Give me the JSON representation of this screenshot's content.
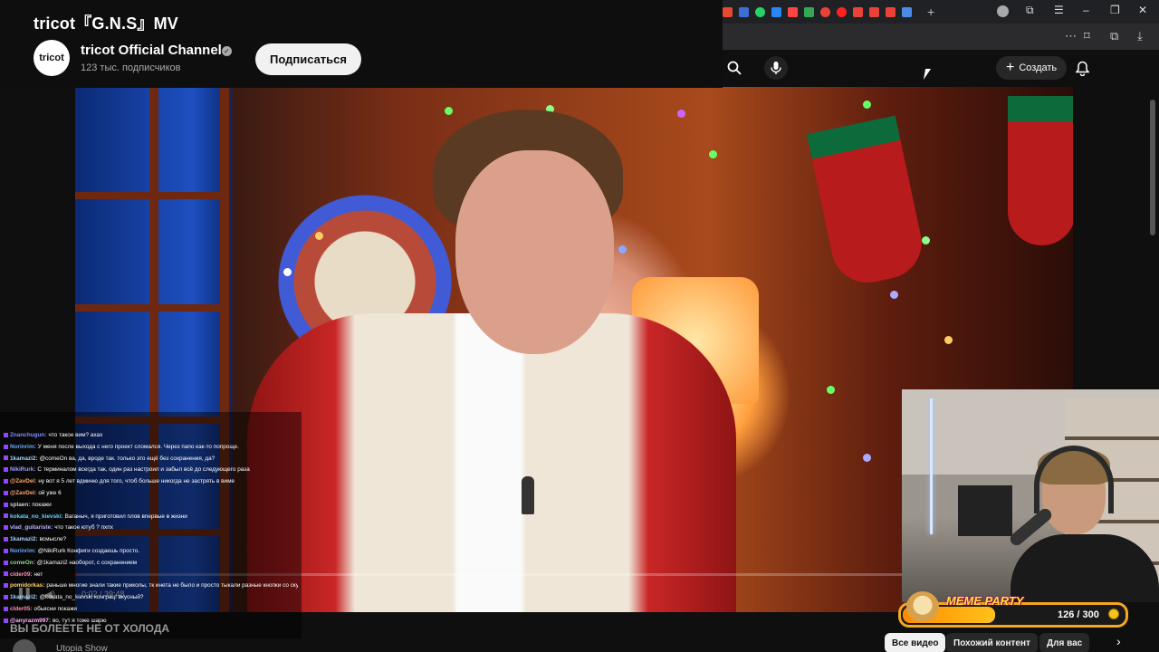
{
  "video": {
    "title": "tricot『G.N.S』MV",
    "channel": "tricot Official Channel",
    "channel_logo_text": "tricot",
    "subscribers": "123 тыс. подписчиков",
    "subscribe_label": "Подписаться",
    "time": "0:02 / 39:48",
    "progress": 0.001
  },
  "header": {
    "create_label": "Создать"
  },
  "chat": [
    {
      "user": "Znanchugun",
      "text": "что такое вим? ахах",
      "color": "#7c8cff"
    },
    {
      "user": "Norinrim",
      "text": "У меня после выхода с него проект сломался. Через папо как-то попроще.",
      "color": "#6aa7ff"
    },
    {
      "user": "1kamazi2",
      "text": "@comeOn ва, да, вроде так. только это ещё без сохранения, да?",
      "color": "#a4d5ff"
    },
    {
      "user": "NikiRurk",
      "text": "С терминалом всегда так, один раз настроил и забыл всё до следующего раза",
      "color": "#9f9bff"
    },
    {
      "user": "@ZavDel",
      "text": "ну вот я 5 лет вдминю для того, чтоб больше никогда не застрять в виме",
      "color": "#ffa36b"
    },
    {
      "user": "@ZavDel",
      "text": "ой уже 6",
      "color": "#ffa36b"
    },
    {
      "user": "splaen",
      "text": "покажи",
      "color": "#cfcfcf"
    },
    {
      "user": "kokata_no_kievski",
      "text": "Ваганыч, я приготовил плов впервые в жизни",
      "color": "#66d3ff"
    },
    {
      "user": "vlad_guitariste",
      "text": "что такое ютуб ? пхпх",
      "color": "#b4b4ff"
    },
    {
      "user": "1kamazi2",
      "text": "всмысле?",
      "color": "#a4d5ff"
    },
    {
      "user": "Norinrim",
      "text": "@NikiRurk Конфиги создаешь просто.",
      "color": "#6aa7ff"
    },
    {
      "user": "comeOn",
      "text": "@1kamazi2 наоборот, с сохранением",
      "color": "#8fd18f"
    },
    {
      "user": "clder09",
      "text": "нет",
      "color": "#ff8fb1"
    },
    {
      "user": "pomidorkas",
      "text": "раньше многие знали такие приколы, тк инета не было и просто тыкали разные кнопки со скуки",
      "color": "#ffd36b"
    },
    {
      "user": "1kamazi2",
      "text": "@kokata_no_kievski конграц! вкусный?",
      "color": "#a4d5ff"
    },
    {
      "user": "clder05",
      "text": "обьясни покажи",
      "color": "#ff8fb1"
    },
    {
      "user": "@anyrazm997",
      "text": "во, тут я тоже шарю",
      "color": "#ffb3ff"
    }
  ],
  "meme_party": {
    "title": "MEME PARTY",
    "count": "126 / 300",
    "fraction": 0.42
  },
  "bottom": {
    "caption": "ВЫ БОЛЕЕТЕ НЕ ОТ ХОЛОДА",
    "channel": "Utopia Show",
    "chips": [
      "Все видео",
      "Похожий контент",
      "Для вас"
    ]
  },
  "colors": {
    "subscribe_bg": "#f1f1f1",
    "meme_border": "#f5a623",
    "progress": "#ff0000"
  },
  "icons": [
    "search-icon",
    "mic-icon",
    "plus-icon",
    "bell-icon",
    "verified-icon",
    "chevron-right-icon",
    "play-icon",
    "volume-icon",
    "coin-icon"
  ]
}
